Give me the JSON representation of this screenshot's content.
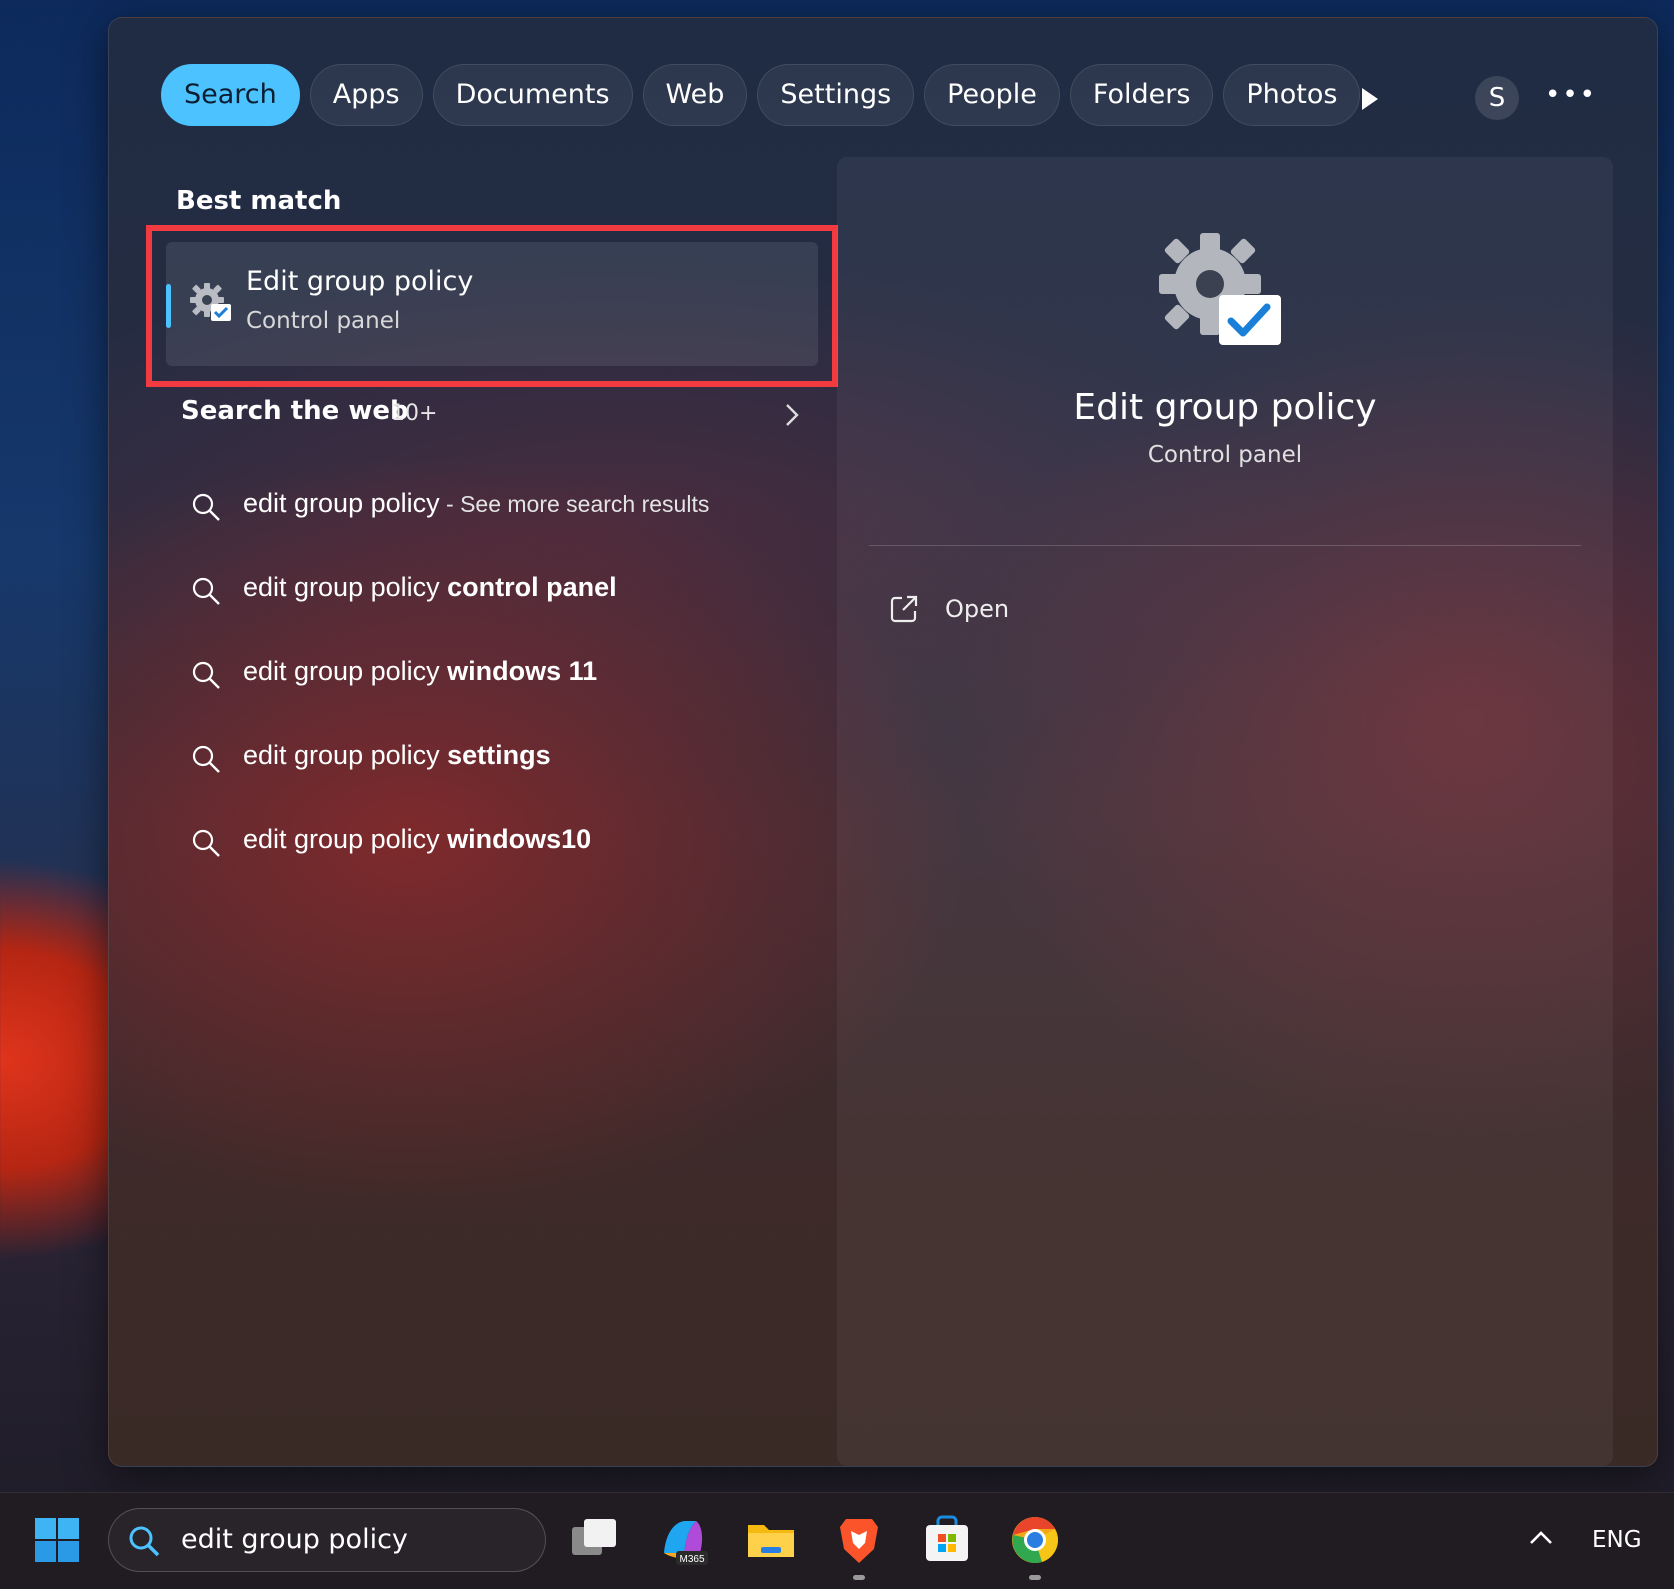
{
  "tabs": [
    {
      "label": "Search",
      "active": true
    },
    {
      "label": "Apps"
    },
    {
      "label": "Documents"
    },
    {
      "label": "Web"
    },
    {
      "label": "Settings"
    },
    {
      "label": "People"
    },
    {
      "label": "Folders"
    },
    {
      "label": "Photos"
    }
  ],
  "icons": {
    "play": "play-icon",
    "more": "more-icon",
    "gear": "gear-check-icon",
    "search": "search-icon",
    "open": "open-external-icon",
    "chevron": "chevron-right-icon"
  },
  "account": {
    "initial": "S"
  },
  "more_label": "•••",
  "best_match": {
    "heading": "Best match",
    "title": "Edit group policy",
    "subtitle": "Control panel"
  },
  "web": {
    "heading": "Search the web",
    "count": "10+",
    "results": [
      {
        "plain": "edit group policy",
        "bold": "",
        "hint": " - See more search results"
      },
      {
        "plain": "edit group policy ",
        "bold": "control panel",
        "hint": ""
      },
      {
        "plain": "edit group policy ",
        "bold": "windows 11",
        "hint": ""
      },
      {
        "plain": "edit group policy ",
        "bold": "settings",
        "hint": ""
      },
      {
        "plain": "edit group policy ",
        "bold": "windows10",
        "hint": ""
      }
    ]
  },
  "detail": {
    "title": "Edit group policy",
    "subtitle": "Control panel",
    "actions": [
      {
        "label": "Open"
      }
    ]
  },
  "taskbar": {
    "search_text": "edit group policy",
    "apps": [
      "task-view",
      "microsoft-365-copilot",
      "file-explorer",
      "brave-browser",
      "microsoft-store",
      "chrome-canary"
    ],
    "language": "ENG"
  },
  "colors": {
    "accent": "#4cc2ff",
    "highlight_border": "#f23b40"
  }
}
